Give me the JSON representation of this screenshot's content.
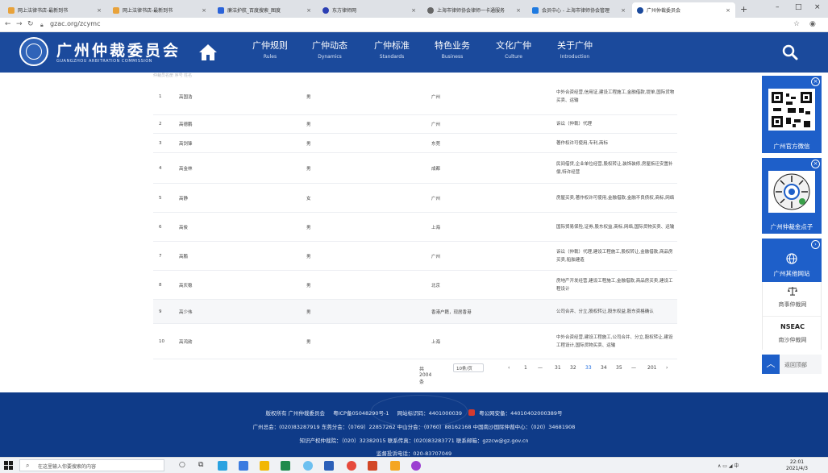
{
  "browser": {
    "tabs": [
      {
        "title": "网上法律书店-最新到书",
        "active": false,
        "color": "#e8a23a"
      },
      {
        "title": "网上法律书店-最新到书",
        "active": false,
        "color": "#e8a23a"
      },
      {
        "title": "廉洁护航_百度搜索_图度",
        "active": false,
        "color": "#2b63d9"
      },
      {
        "title": "东方律师网",
        "active": false,
        "color": "#2b3fb3"
      },
      {
        "title": "上海市律师协会律师一卡通服务",
        "active": false,
        "color": "#666666"
      },
      {
        "title": "会员中心 - 上海市律师协会管理",
        "active": false,
        "color": "#1f7ae0"
      },
      {
        "title": "广州仲裁委员会",
        "active": true,
        "color": "#1b4a9c"
      }
    ],
    "new_tab_glyph": "+",
    "window_controls": [
      "–",
      "□",
      "×"
    ],
    "url": "gzac.org/zcymc"
  },
  "header": {
    "brand_zh": "广州仲裁委员会",
    "brand_en": "GUANGZHOU ARBITRATION COMMISSION",
    "nav": [
      {
        "zh": "广仲规则",
        "en": "Rules"
      },
      {
        "zh": "广仲动态",
        "en": "Dynamics"
      },
      {
        "zh": "广仲标准",
        "en": "Standards"
      },
      {
        "zh": "特色业务",
        "en": "Business"
      },
      {
        "zh": "文化广仲",
        "en": "Culture"
      },
      {
        "zh": "关于广仲",
        "en": "Introduction"
      }
    ]
  },
  "table": {
    "ghost_header": "仲裁员名册 序号 姓名",
    "rows": [
      {
        "no": "1",
        "name": "高国浩",
        "sex": "男",
        "loc": "广州",
        "exp": "中外合资经营,信用证,建设工程施工,金融借款,提单,国际货物买卖、运输"
      },
      {
        "no": "2",
        "name": "高德鹏",
        "sex": "男",
        "loc": "广州",
        "exp": "诉讼（仲裁）代理"
      },
      {
        "no": "3",
        "name": "高剑锋",
        "sex": "男",
        "loc": "东莞",
        "exp": "著作权许可使用,专利,商标"
      },
      {
        "no": "4",
        "name": "高金林",
        "sex": "男",
        "loc": "成都",
        "exp": "民间借贷,企业单位经营,股权转让,装饰装修,房屋拆迁安置补偿,特许经营"
      },
      {
        "no": "5",
        "name": "高静",
        "sex": "女",
        "loc": "广州",
        "exp": "房屋买卖,著作权许可使用,金融借款,金融不良债权,商标,网络"
      },
      {
        "no": "6",
        "name": "高俊",
        "sex": "男",
        "loc": "上海",
        "exp": "国际贸易保险,证券,股东权益,商标,网络,国际货物买卖、运输"
      },
      {
        "no": "7",
        "name": "高鹏",
        "sex": "男",
        "loc": "广州",
        "exp": "诉讼（仲裁）代理,建设工程施工,股权转让,金融借款,商品房买卖,船舶建造"
      },
      {
        "no": "8",
        "name": "高庆稳",
        "sex": "男",
        "loc": "北京",
        "exp": "房地产开发经营,建设工程施工,金融借款,商品房买卖,建设工程设计"
      },
      {
        "no": "9",
        "name": "高少伟",
        "sex": "男",
        "loc": "香港户籍，现居香港",
        "exp": "公司合并、分立,股权转让,股东权益,股东资格确认"
      },
      {
        "no": "10",
        "name": "高鸿勋",
        "sex": "男",
        "loc": "上海",
        "exp": "中外合资经营,建设工程施工,公司合并、分立,股权转让,建设工程设计,国际货物买卖、运输"
      }
    ]
  },
  "pagination": {
    "total": "共 2004 条",
    "page_size": "10条/页",
    "prev": "‹",
    "next": "›",
    "pages": [
      "1",
      "—",
      "31",
      "32",
      "33",
      "34",
      "35",
      "—",
      "201"
    ],
    "current": "33"
  },
  "sidebar": {
    "card1_label": "广州官方微信",
    "card2_label": "广州仲裁金点子",
    "card3_label": "广州其他网站",
    "link1": "商事仲裁网",
    "link2_logo": "NSEAC",
    "link2": "南沙仲裁网",
    "back_top": "返回顶部",
    "close_glyph": "×"
  },
  "footer": {
    "line1_a": "版权所有 广州仲裁委员会",
    "line1_b": "粤ICP备05048290号-1",
    "line1_c": "网站标识码：4401000039",
    "line1_d": "粤公网安备：44010402000389号",
    "line2": "广州总会：(020)83287919  东莞分会：（0769）22857262  中山分会：（0760）88162168  中国南沙国际仲裁中心：（020）34681908",
    "line3": "知识产权仲裁院：（020）32382015  联系传真：(020)83283771  联系邮箱：gzzcw@gz.gov.cn",
    "line4": "监督投诉电话：020-83707049"
  },
  "taskbar": {
    "search_placeholder": "在这里输入你要搜索的内容",
    "clock_time": "22:01",
    "clock_date": "2021/4/3",
    "tray_text": "∧ ▭ ◢ 中"
  },
  "colors": {
    "header_blue": "#1b4a9c",
    "footer_blue": "#0f3b88",
    "accent_blue": "#1e5fc9"
  }
}
